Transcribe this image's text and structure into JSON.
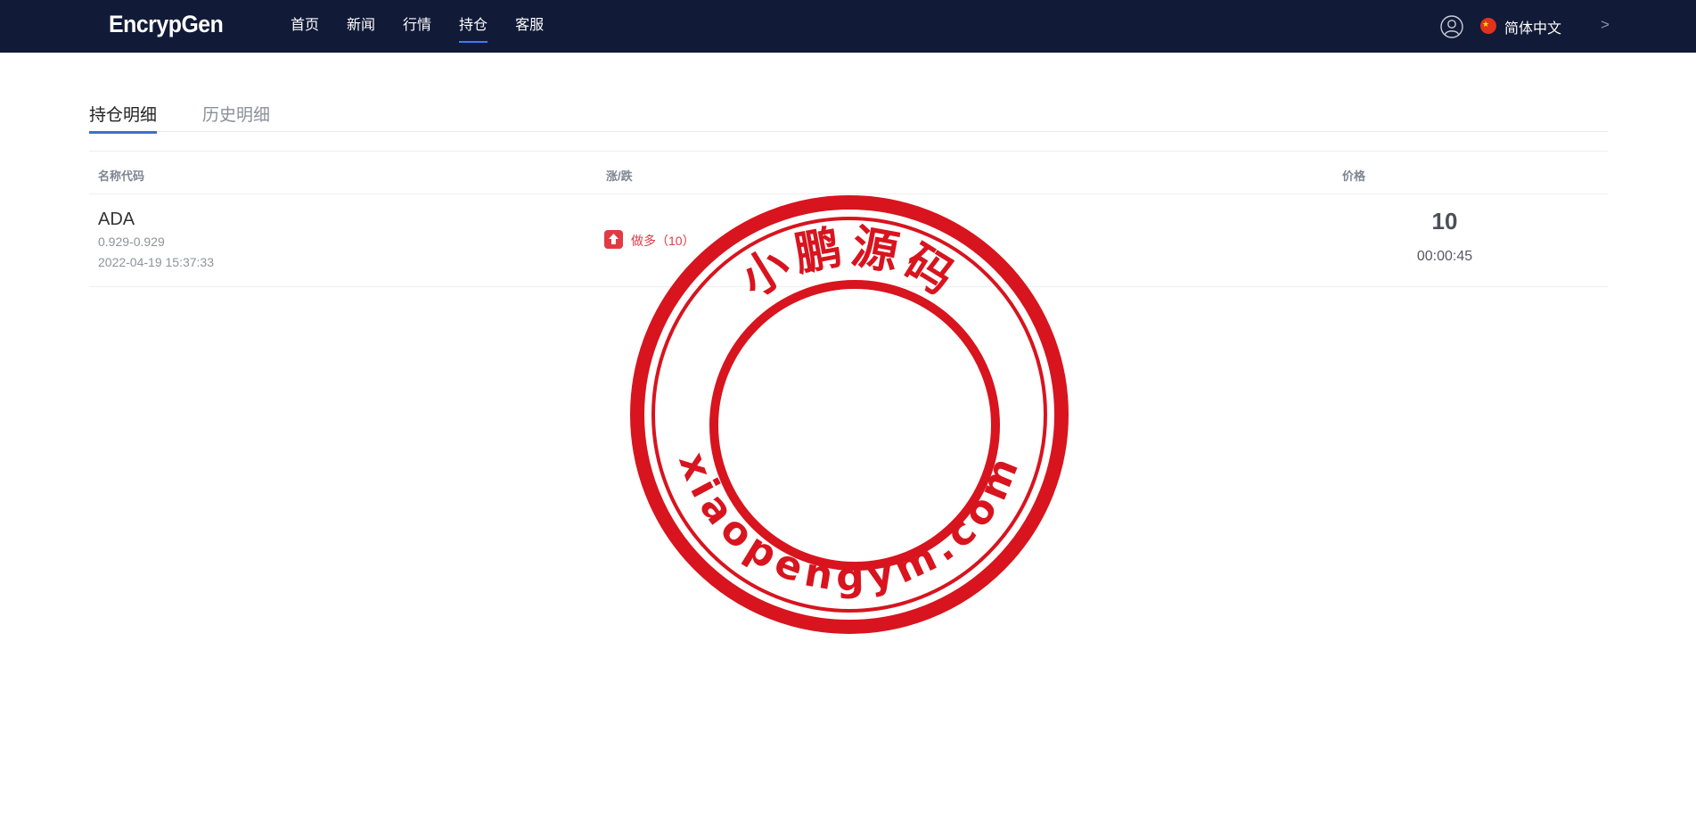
{
  "header": {
    "logo": "EncrypGen",
    "nav": [
      "首页",
      "新闻",
      "行情",
      "持仓",
      "客服"
    ],
    "active_nav": "持仓",
    "language": "简体中文",
    "chevron": ">"
  },
  "tabs": [
    "持仓明细",
    "历史明细"
  ],
  "active_tab": "持仓明细",
  "table": {
    "columns": [
      "名称代码",
      "涨/跌",
      "价格"
    ],
    "rows": [
      {
        "symbol": "ADA",
        "range": "0.929-0.929",
        "date": "2022-04-19 15:37:33",
        "direction": "做多（10）",
        "price": "10",
        "timer": "00:00:45"
      }
    ]
  },
  "stamp": {
    "top_text": "小鹏源码",
    "bottom_text": "xiaopengym.com",
    "color": "#d8141e"
  },
  "colors": {
    "topbar": "#111a36",
    "accent": "#3c6fd0",
    "up": "#e23a44"
  },
  "icons": [
    "user-icon",
    "china-flag-icon",
    "chevron-right-icon",
    "arrow-up-icon"
  ]
}
